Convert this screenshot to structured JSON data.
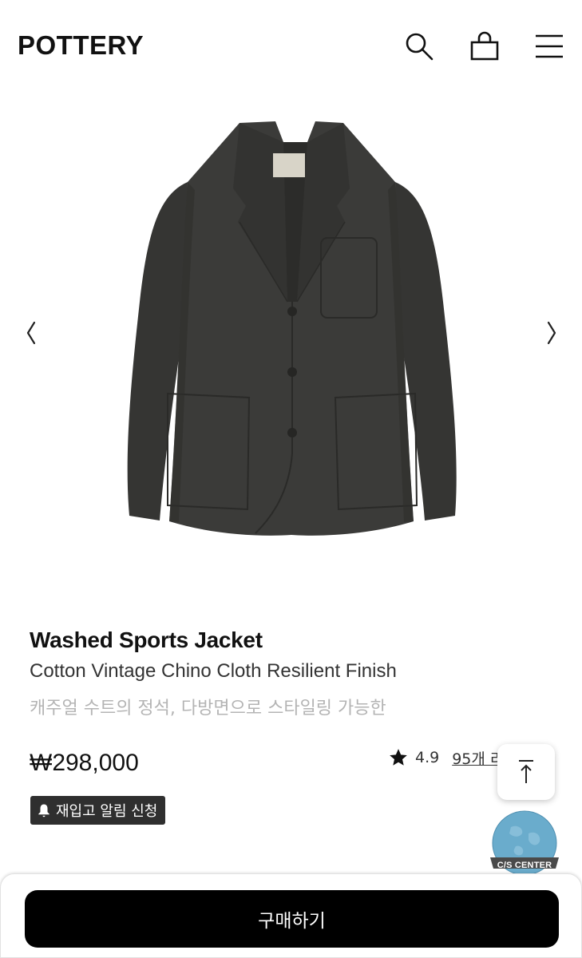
{
  "header": {
    "logo": "POTTERY",
    "icons": [
      "search-icon",
      "shopping-bag-icon",
      "menu-icon"
    ]
  },
  "gallery": {
    "prev_icon": "chevron-left-icon",
    "next_icon": "chevron-right-icon",
    "image": "product-jacket-image"
  },
  "product": {
    "title": "Washed Sports Jacket",
    "subtitle": "Cotton Vintage Chino Cloth Resilient Finish",
    "description": "캐주얼 수트의 정석, 다방면으로 스타일링 가능한",
    "price": "₩298,000",
    "rating": "4.9",
    "reviews_link": "95개 리",
    "restock_label": "재입고 알림 신청"
  },
  "floating": {
    "scroll_top_icon": "arrow-up-icon",
    "cs_label": "C/S CENTER"
  },
  "bottom_bar": {
    "buy_label": "구매하기"
  },
  "colors": {
    "jacket": "#3a3a38",
    "button": "#000000",
    "restock_bg": "#2f2f2f",
    "globe": "#6aaccc"
  }
}
